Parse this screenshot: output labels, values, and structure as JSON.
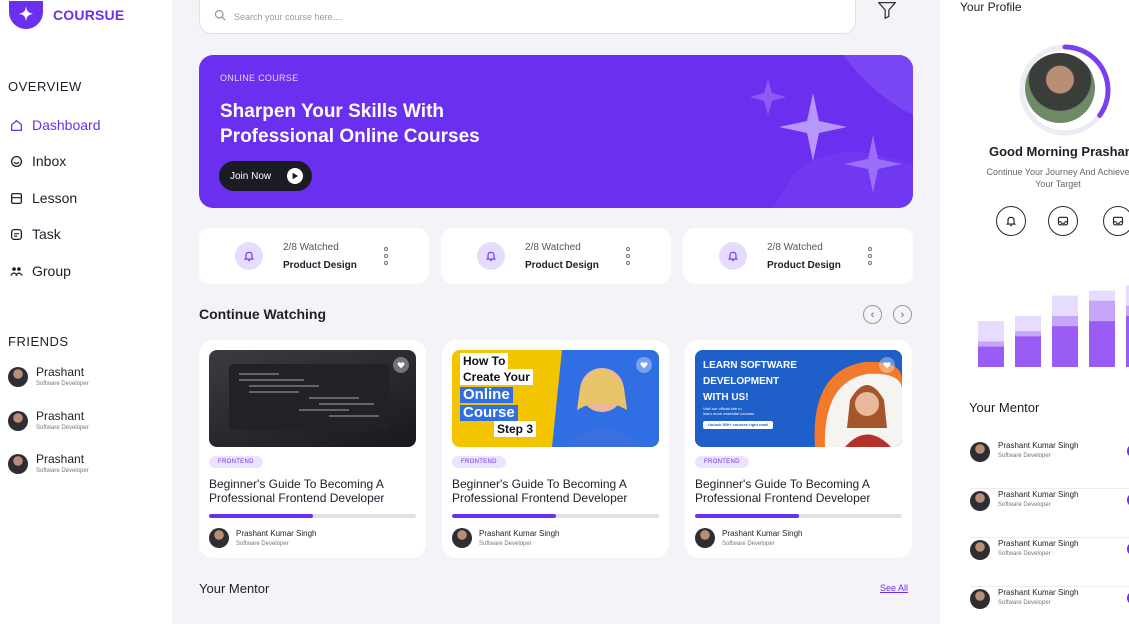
{
  "brand": {
    "name": "COURSUE",
    "color": "#6b2ff0"
  },
  "sidebar": {
    "overview_title": "OVERVIEW",
    "items": [
      {
        "label": "Dashboard",
        "icon": "home-icon",
        "active": true
      },
      {
        "label": "Inbox",
        "icon": "inbox-icon",
        "active": false
      },
      {
        "label": "Lesson",
        "icon": "book-icon",
        "active": false
      },
      {
        "label": "Task",
        "icon": "task-icon",
        "active": false
      },
      {
        "label": "Group",
        "icon": "group-icon",
        "active": false
      }
    ],
    "friends_title": "FRIENDS",
    "friends": [
      {
        "name": "Prashant",
        "role": "Software Developer"
      },
      {
        "name": "Prashant",
        "role": "Software Developer"
      },
      {
        "name": "Prashant",
        "role": "Software Developer"
      }
    ]
  },
  "search": {
    "placeholder": "Search your course here...."
  },
  "hero": {
    "tag": "ONLINE COURSE",
    "title": "Sharpen  Your Skills With Professional Online Courses",
    "button": "Join Now"
  },
  "stats": [
    {
      "watched": "2/8 Watched",
      "title": "Product Design"
    },
    {
      "watched": "2/8 Watched",
      "title": "Product Design"
    },
    {
      "watched": "2/8 Watched",
      "title": "Product Design"
    }
  ],
  "continue_watching": {
    "title": "Continue Watching",
    "courses": [
      {
        "badge": "FRONTEND",
        "title": "Beginner's Guide To Becoming A Professional Frontend Developer",
        "progress": 0.5,
        "mentor": "Prashant Kumar Singh",
        "mentor_role": "Software Developer",
        "thumb": {
          "lines": []
        }
      },
      {
        "badge": "FRONTEND",
        "title": "Beginner's Guide To Becoming A Professional Frontend Developer",
        "progress": 0.5,
        "mentor": "Prashant Kumar Singh",
        "mentor_role": "Software Developer",
        "thumb": {
          "lines": [
            "How To",
            "Create Your",
            "Online",
            "Course",
            "Step 3"
          ]
        }
      },
      {
        "badge": "FRONTEND",
        "title": "Beginner's Guide To Becoming A Professional Frontend Developer",
        "progress": 0.5,
        "mentor": "Prashant Kumar Singh",
        "mentor_role": "Software Developer",
        "thumb": {
          "lines": [
            "LEARN SOFTWARE",
            "DEVELOPMENT",
            "WITH US!",
            "Visit our official site to",
            "learn more essential courses",
            "Unlock 500+ courses right now!"
          ]
        }
      }
    ]
  },
  "your_mentor": {
    "title": "Your Mentor",
    "see_all": "See All"
  },
  "profile": {
    "title": "Your Profile",
    "greeting": "Good Morning Prashant",
    "sub_line1": "Continue Your Journey And Achieve",
    "sub_line2": "Your Target",
    "progress": 0.35,
    "actions": [
      "bell-icon",
      "inbox-icon",
      "inbox-icon"
    ]
  },
  "activity_chart": {
    "bars": [
      [
        0.45,
        0.25,
        0.2
      ],
      [
        0.5,
        0.35,
        0.3
      ],
      [
        0.7,
        0.5,
        0.4
      ],
      [
        0.75,
        0.65,
        0.45
      ],
      [
        0.8,
        0.6,
        0.5
      ]
    ],
    "colors": [
      "#9b5cf5",
      "#c5a6f9",
      "#e6dcfd"
    ]
  },
  "right_mentors": {
    "title": "Your Mentor",
    "items": [
      {
        "name": "Prashant Kumar Singh",
        "role": "Software Developer"
      },
      {
        "name": "Prashant Kumar Singh",
        "role": "Software Developer"
      },
      {
        "name": "Prashant Kumar Singh",
        "role": "Software Developer"
      },
      {
        "name": "Prashant Kumar Singh",
        "role": "Software Developer"
      }
    ]
  }
}
